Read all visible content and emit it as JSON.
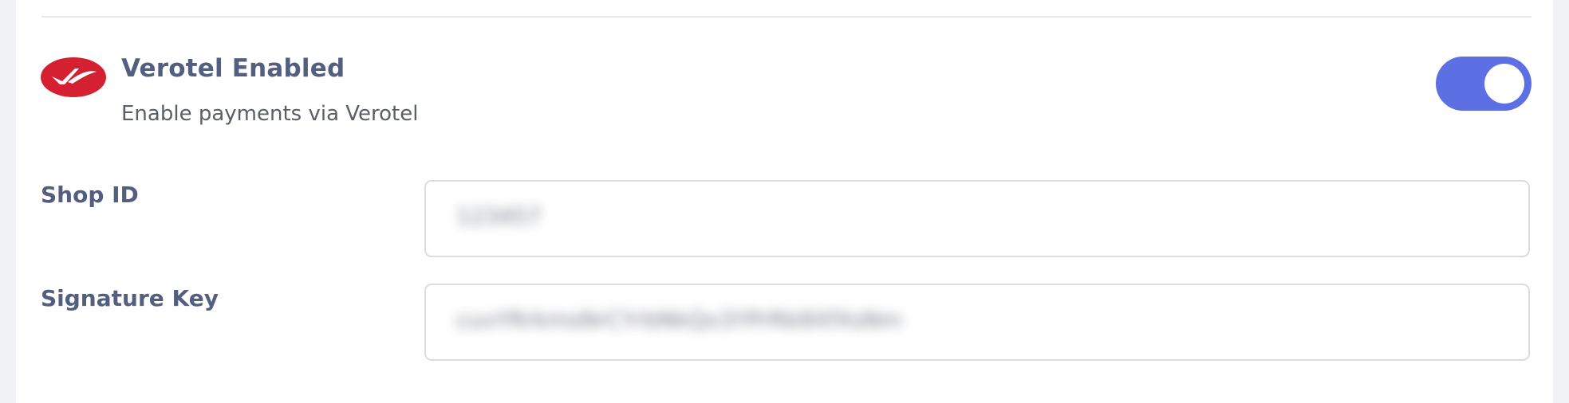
{
  "gateway": {
    "title": "Verotel Enabled",
    "subtitle": "Enable payments via Verotel",
    "enabled": true,
    "logo_icon": "verotel-logo-icon",
    "logo_color": "#d42030",
    "accent_color": "#5c6fe3"
  },
  "fields": {
    "shop_id": {
      "label": "Shop ID",
      "value": "123457"
    },
    "signature_key": {
      "label": "Signature Key",
      "value": "cuvYRrkmsNrCYrbNkQx3YPrRb9XfXsNm"
    }
  }
}
